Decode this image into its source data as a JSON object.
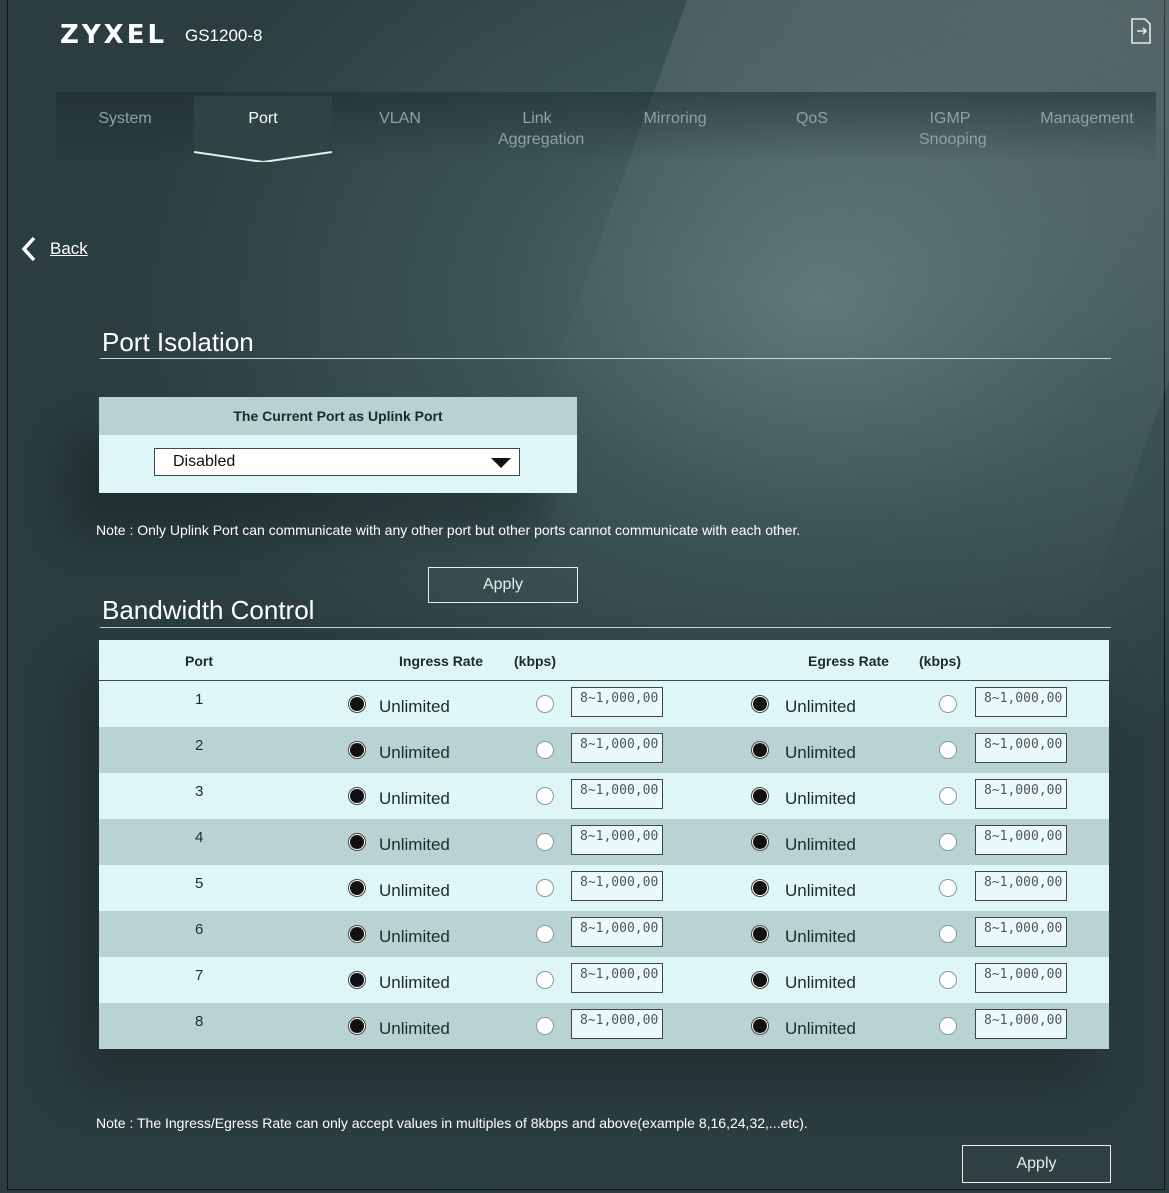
{
  "header": {
    "brand": "ZYXEL",
    "model": "GS1200-8"
  },
  "nav": {
    "tabs": [
      {
        "label": "System",
        "active": false
      },
      {
        "label": "Port",
        "active": true
      },
      {
        "label": "VLAN",
        "active": false
      },
      {
        "label": "Link Aggregation",
        "active": false
      },
      {
        "label": "Mirroring",
        "active": false
      },
      {
        "label": "QoS",
        "active": false
      },
      {
        "label": "IGMP Snooping",
        "active": false
      },
      {
        "label": "Management",
        "active": false
      }
    ]
  },
  "back_label": "Back",
  "port_isolation": {
    "title": "Port Isolation",
    "uplink_header": "The Current Port as Uplink Port",
    "uplink_value": "Disabled",
    "note": "Note : Only Uplink Port can communicate with any other port but other ports cannot communicate with each other.",
    "apply_label": "Apply"
  },
  "bandwidth_control": {
    "title": "Bandwidth Control",
    "columns": {
      "port": "Port",
      "ingress": "Ingress Rate",
      "ingress_unit": "(kbps)",
      "egress": "Egress Rate",
      "egress_unit": "(kbps)"
    },
    "rows": [
      {
        "port": "1",
        "ingress_mode": "Unlimited",
        "ingress_value": "8~1,000,00",
        "egress_mode": "Unlimited",
        "egress_value": "8~1,000,00"
      },
      {
        "port": "2",
        "ingress_mode": "Unlimited",
        "ingress_value": "8~1,000,00",
        "egress_mode": "Unlimited",
        "egress_value": "8~1,000,00"
      },
      {
        "port": "3",
        "ingress_mode": "Unlimited",
        "ingress_value": "8~1,000,00",
        "egress_mode": "Unlimited",
        "egress_value": "8~1,000,00"
      },
      {
        "port": "4",
        "ingress_mode": "Unlimited",
        "ingress_value": "8~1,000,00",
        "egress_mode": "Unlimited",
        "egress_value": "8~1,000,00"
      },
      {
        "port": "5",
        "ingress_mode": "Unlimited",
        "ingress_value": "8~1,000,00",
        "egress_mode": "Unlimited",
        "egress_value": "8~1,000,00"
      },
      {
        "port": "6",
        "ingress_mode": "Unlimited",
        "ingress_value": "8~1,000,00",
        "egress_mode": "Unlimited",
        "egress_value": "8~1,000,00"
      },
      {
        "port": "7",
        "ingress_mode": "Unlimited",
        "ingress_value": "8~1,000,00",
        "egress_mode": "Unlimited",
        "egress_value": "8~1,000,00"
      },
      {
        "port": "8",
        "ingress_mode": "Unlimited",
        "ingress_value": "8~1,000,00",
        "egress_mode": "Unlimited",
        "egress_value": "8~1,000,00"
      }
    ],
    "note": "Note : The Ingress/Egress Rate can only accept values in multiples of 8kbps and above(example 8,16,24,32,...etc).",
    "apply_label": "Apply"
  }
}
